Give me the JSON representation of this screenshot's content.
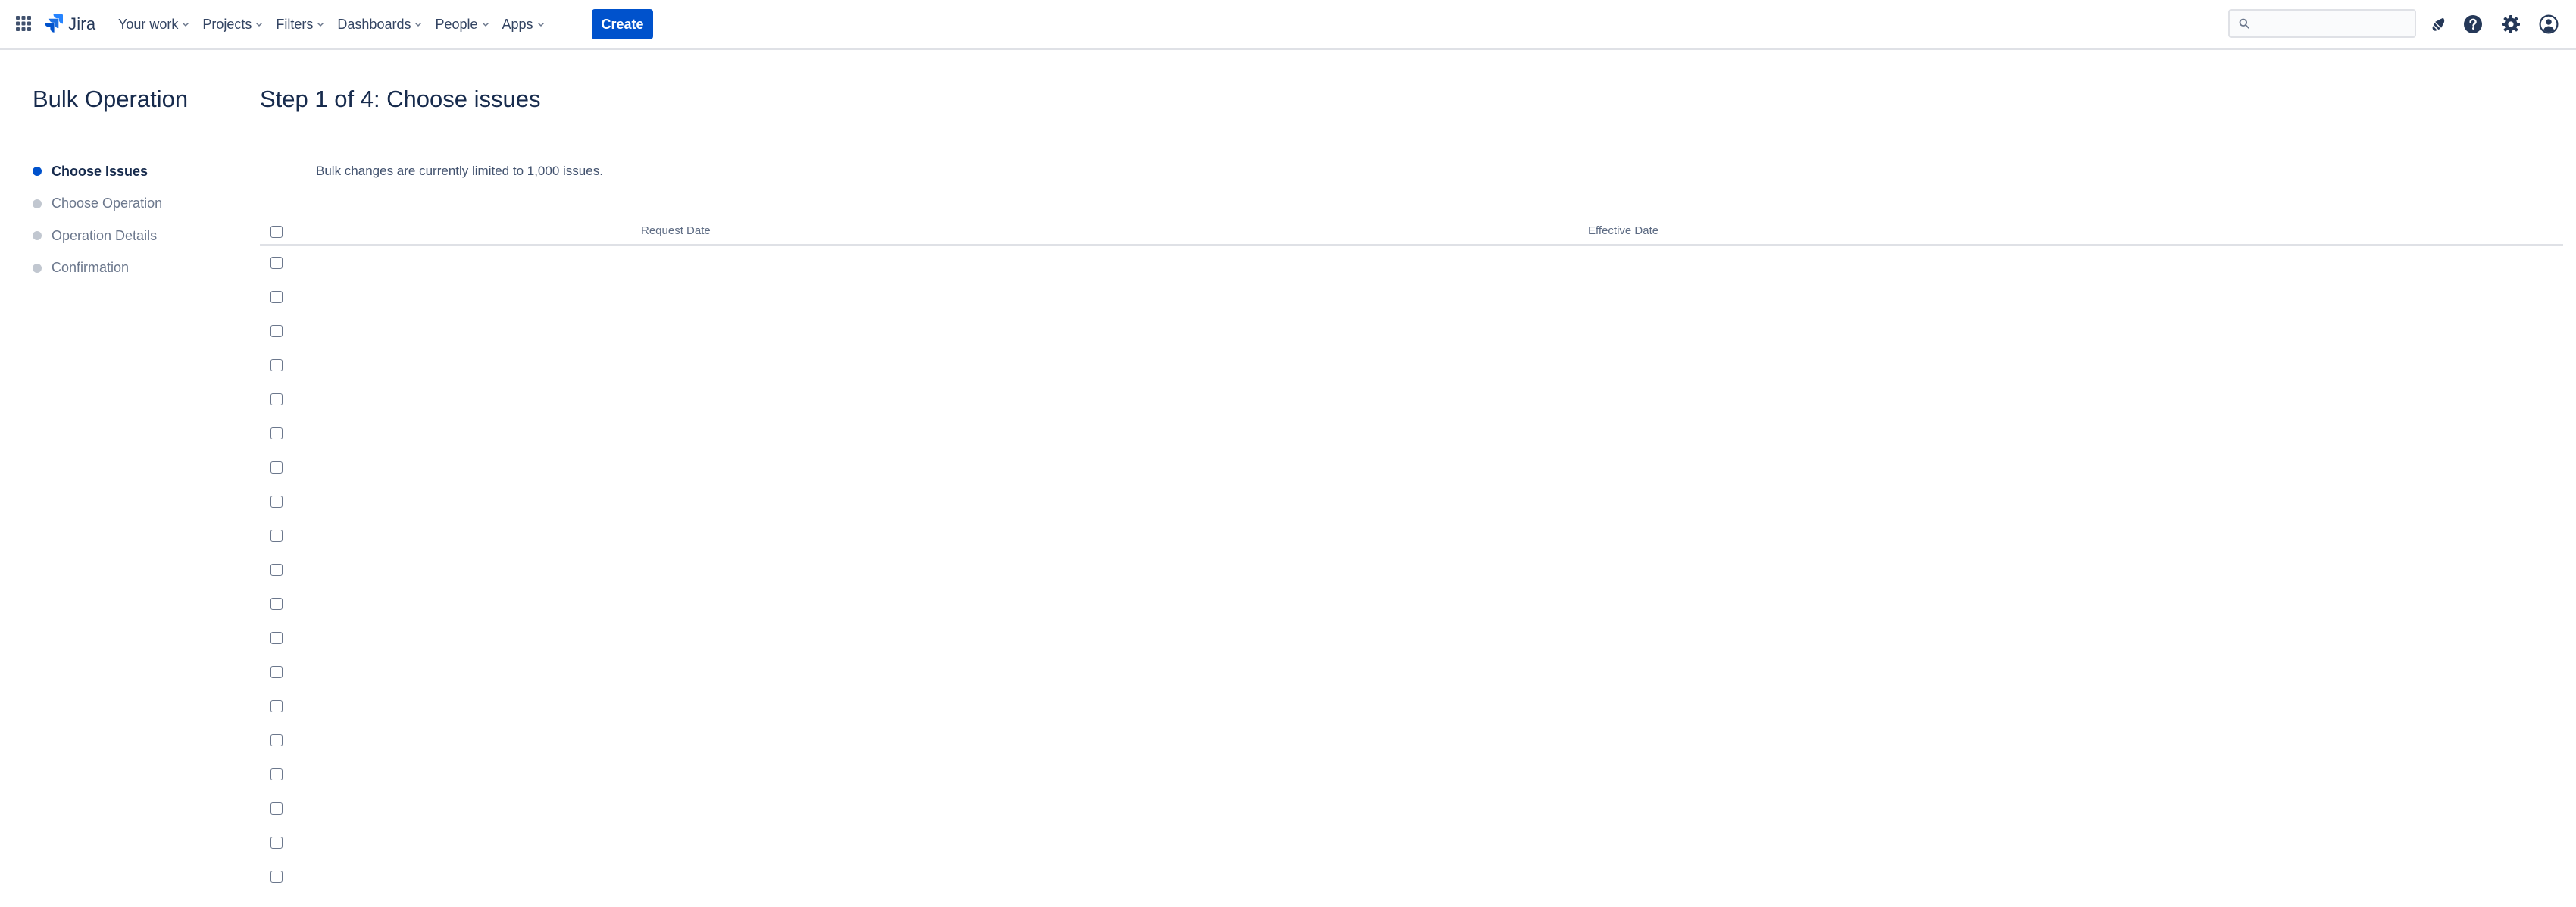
{
  "topnav": {
    "product_name": "Jira",
    "menu": [
      {
        "label": "Your work"
      },
      {
        "label": "Projects"
      },
      {
        "label": "Filters"
      },
      {
        "label": "Dashboards"
      },
      {
        "label": "People"
      },
      {
        "label": "Apps"
      }
    ],
    "create_label": "Create",
    "search": {
      "placeholder": "",
      "value": ""
    },
    "icons": [
      "app-switcher-icon",
      "jira-logo-icon",
      "search-icon",
      "notifications-icon",
      "help-icon",
      "settings-icon",
      "profile-icon"
    ],
    "accent_color": "#0052cc"
  },
  "sidebar": {
    "title": "Bulk Operation",
    "steps": [
      {
        "label": "Choose Issues",
        "active": true
      },
      {
        "label": "Choose Operation",
        "active": false
      },
      {
        "label": "Operation Details",
        "active": false
      },
      {
        "label": "Confirmation",
        "active": false
      }
    ]
  },
  "main": {
    "title": "Step 1 of 4: Choose issues",
    "notice": "Bulk changes are currently limited to 1,000 issues.",
    "table": {
      "columns": [
        "Request Date",
        "Effective Date"
      ],
      "rows": [
        {
          "request_date": "",
          "effective_date": ""
        },
        {
          "request_date": "",
          "effective_date": ""
        },
        {
          "request_date": "",
          "effective_date": ""
        },
        {
          "request_date": "",
          "effective_date": ""
        },
        {
          "request_date": "",
          "effective_date": ""
        },
        {
          "request_date": "",
          "effective_date": ""
        },
        {
          "request_date": "",
          "effective_date": ""
        },
        {
          "request_date": "",
          "effective_date": ""
        },
        {
          "request_date": "",
          "effective_date": ""
        },
        {
          "request_date": "",
          "effective_date": ""
        },
        {
          "request_date": "",
          "effective_date": ""
        },
        {
          "request_date": "",
          "effective_date": ""
        },
        {
          "request_date": "",
          "effective_date": ""
        },
        {
          "request_date": "",
          "effective_date": ""
        },
        {
          "request_date": "",
          "effective_date": ""
        },
        {
          "request_date": "",
          "effective_date": ""
        },
        {
          "request_date": "",
          "effective_date": ""
        },
        {
          "request_date": "",
          "effective_date": ""
        },
        {
          "request_date": "",
          "effective_date": ""
        },
        {
          "request_date": "",
          "effective_date": ""
        }
      ]
    }
  }
}
